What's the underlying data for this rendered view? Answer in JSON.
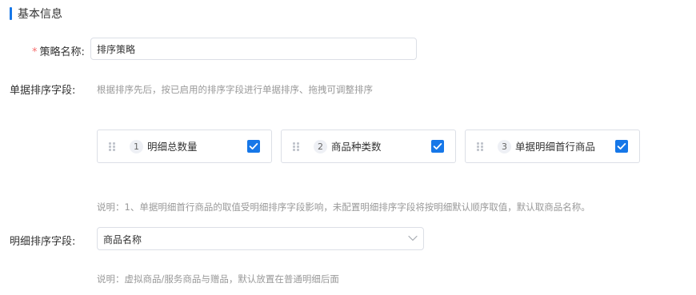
{
  "section": {
    "title": "基本信息"
  },
  "strategy_name": {
    "required_mark": "*",
    "label": "策略名称:",
    "value": "排序策略"
  },
  "doc_sort": {
    "label": "单据排序字段:",
    "hint": "根据排序先后，按已启用的排序字段进行单据排序、拖拽可调整排序",
    "items": [
      {
        "index": "1",
        "label": "明细总数量",
        "checked": true
      },
      {
        "index": "2",
        "label": "商品种类数",
        "checked": true
      },
      {
        "index": "3",
        "label": "单据明细首行商品",
        "checked": true
      }
    ],
    "note": "说明：1、单据明细首行商品的取值受明细排序字段影响，未配置明细排序字段将按明细默认顺序取值，默认取商品名称。"
  },
  "detail_sort": {
    "label": "明细排序字段:",
    "selected": "商品名称",
    "note": "说明：虚拟商品/服务商品与赠品，默认放置在普通明细后面"
  },
  "colors": {
    "accent": "#1677e8",
    "required": "#f56c6c",
    "hint": "#999999",
    "border": "#dcdfe6"
  },
  "icons": {
    "drag": "drag-handle-icon",
    "check": "check-icon",
    "dropdown": "chevron-down-icon"
  }
}
